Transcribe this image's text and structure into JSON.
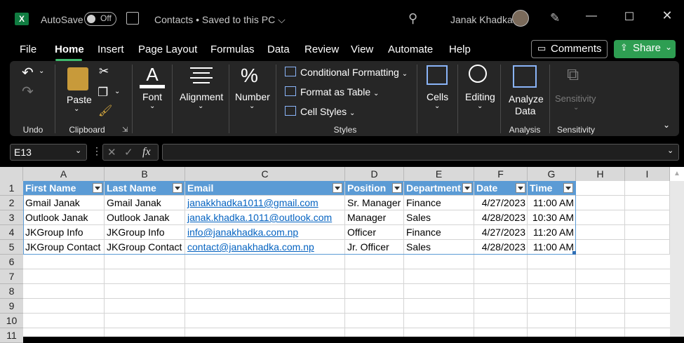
{
  "titlebar": {
    "logo_letter": "X",
    "autosave_label": "AutoSave",
    "autosave_state": "Off",
    "doc_title": "Contacts • Saved to this PC",
    "user_name": "Janak Khadka"
  },
  "menu": {
    "items": [
      "File",
      "Home",
      "Insert",
      "Page Layout",
      "Formulas",
      "Data",
      "Review",
      "View",
      "Automate",
      "Help"
    ],
    "active": "Home",
    "comments_label": "Comments",
    "share_label": "Share"
  },
  "ribbon": {
    "undo_group": "Undo",
    "clipboard_group": "Clipboard",
    "paste_label": "Paste",
    "font_label": "Font",
    "alignment_label": "Alignment",
    "number_label": "Number",
    "conditional_formatting": "Conditional Formatting",
    "format_as_table": "Format as Table",
    "cell_styles": "Cell Styles",
    "styles_group": "Styles",
    "cells_label": "Cells",
    "editing_label": "Editing",
    "analyze_data_line1": "Analyze",
    "analyze_data_line2": "Data",
    "analysis_group": "Analysis",
    "sensitivity_label": "Sensitivity",
    "sensitivity_group": "Sensitivity"
  },
  "formula_bar": {
    "name_box": "E13",
    "fx": "fx",
    "formula": ""
  },
  "sheet": {
    "columns": [
      "A",
      "B",
      "C",
      "D",
      "E",
      "F",
      "G",
      "H",
      "I"
    ],
    "rows": [
      "1",
      "2",
      "3",
      "4",
      "5",
      "6",
      "7",
      "8",
      "9",
      "10",
      "11"
    ],
    "headers": [
      "First Name",
      "Last Name",
      "Email",
      "Position",
      "Department",
      "Date",
      "Time"
    ],
    "data": [
      [
        "Gmail Janak",
        "Gmail Janak",
        "janakkhadka1011@gmail.com",
        "Sr. Manager",
        "Finance",
        "4/27/2023",
        "11:00 AM"
      ],
      [
        "Outlook Janak",
        "Outlook Janak",
        "janak.khadka.1011@outlook.com",
        "Manager",
        "Sales",
        "4/28/2023",
        "10:30 AM"
      ],
      [
        "JKGroup Info",
        "JKGroup Info",
        "info@janakhadka.com.np",
        "Officer",
        "Finance",
        "4/27/2023",
        "11:20 AM"
      ],
      [
        "JKGroup Contact",
        "JKGroup Contact",
        "contact@janakhadka.com.np",
        "Jr. Officer",
        "Sales",
        "4/28/2023",
        "11:00 AM"
      ]
    ]
  },
  "colors": {
    "excel_green": "#107c41",
    "share_green": "#2e9e52",
    "table_header_blue": "#5b9bd5",
    "link_blue": "#0563c1"
  }
}
